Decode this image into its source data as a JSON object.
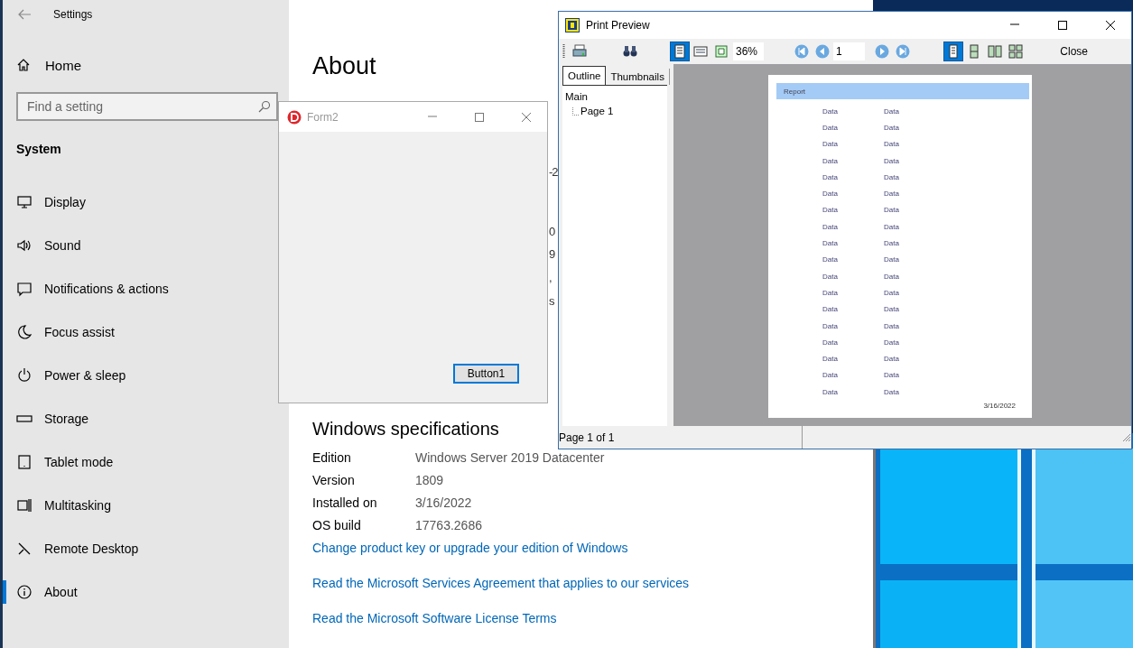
{
  "settings": {
    "title": "Settings",
    "home": "Home",
    "search": {
      "placeholder": "Find a setting"
    },
    "section": "System",
    "nav": [
      {
        "label": "Display",
        "selected": false
      },
      {
        "label": "Sound",
        "selected": false
      },
      {
        "label": "Notifications & actions",
        "selected": false
      },
      {
        "label": "Focus assist",
        "selected": false
      },
      {
        "label": "Power & sleep",
        "selected": false
      },
      {
        "label": "Storage",
        "selected": false
      },
      {
        "label": "Tablet mode",
        "selected": false
      },
      {
        "label": "Multitasking",
        "selected": false
      },
      {
        "label": "Remote Desktop",
        "selected": false
      },
      {
        "label": "About",
        "selected": true
      }
    ],
    "page_title": "About",
    "cut_texts": [
      "-2",
      "0",
      "9",
      ",",
      "s"
    ],
    "specs_title": "Windows specifications",
    "specs": [
      {
        "label": "Edition",
        "value": "Windows Server 2019 Datacenter"
      },
      {
        "label": "Version",
        "value": "1809"
      },
      {
        "label": "Installed on",
        "value": "3/16/2022"
      },
      {
        "label": "OS build",
        "value": "17763.2686"
      }
    ],
    "links": [
      "Change product key or upgrade your edition of Windows",
      "Read the Microsoft Services Agreement that applies to our services",
      "Read the Microsoft Software License Terms"
    ]
  },
  "form2": {
    "title": "Form2",
    "button": "Button1"
  },
  "print_preview": {
    "title": "Print Preview",
    "zoom_modes": [
      {
        "selected": true
      },
      {
        "selected": false
      },
      {
        "selected": false
      }
    ],
    "zoom": "36%",
    "page": "1",
    "layouts": [
      {
        "selected": true
      },
      {
        "selected": false
      },
      {
        "selected": false
      },
      {
        "selected": false
      }
    ],
    "close": "Close",
    "tabs": [
      {
        "label": "Outline",
        "selected": true
      },
      {
        "label": "Thumbnails",
        "selected": false
      }
    ],
    "outline": [
      {
        "label": "Main",
        "children": [
          {
            "label": "Page 1"
          }
        ]
      }
    ],
    "report": {
      "title": "Report",
      "rows": [
        [
          "Data",
          "Data"
        ],
        [
          "Data",
          "Data"
        ],
        [
          "Data",
          "Data"
        ],
        [
          "Data",
          "Data"
        ],
        [
          "Data",
          "Data"
        ],
        [
          "Data",
          "Data"
        ],
        [
          "Data",
          "Data"
        ],
        [
          "Data",
          "Data"
        ],
        [
          "Data",
          "Data"
        ],
        [
          "Data",
          "Data"
        ],
        [
          "Data",
          "Data"
        ],
        [
          "Data",
          "Data"
        ],
        [
          "Data",
          "Data"
        ],
        [
          "Data",
          "Data"
        ],
        [
          "Data",
          "Data"
        ],
        [
          "Data",
          "Data"
        ],
        [
          "Data",
          "Data"
        ],
        [
          "Data",
          "Data"
        ]
      ],
      "date": "3/16/2022"
    },
    "status": "Page 1 of 1"
  }
}
